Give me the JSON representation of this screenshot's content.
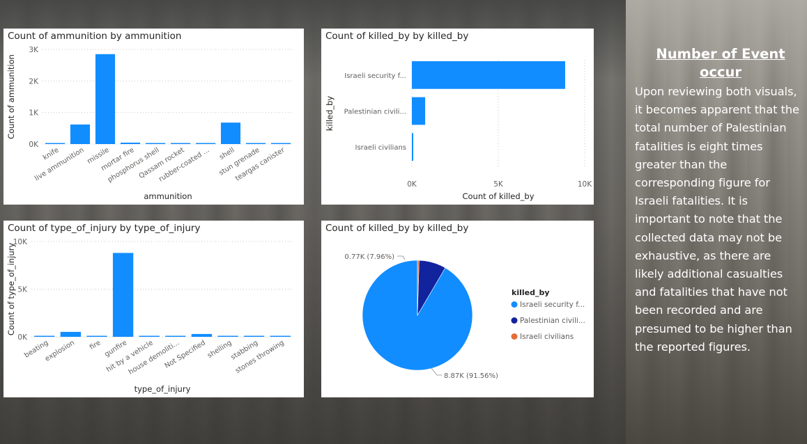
{
  "story": {
    "title": "Number of Event occur ",
    "body": "Upon reviewing both visuals, it becomes apparent that the total number of Palestinian fatalities is eight times greater than the corresponding figure for Israeli fatalities. It is important to note that the collected data may not be exhaustive, as there are likely additional casualties and fatalities that have not been recorded and are presumed to be higher than the reported figures."
  },
  "colors": {
    "bar": "#118DFF",
    "pie_israeli_security": "#118DFF",
    "pie_palestinian_civilians": "#12239E",
    "pie_israeli_civilians": "#E66C37"
  },
  "chart_data": [
    {
      "type": "bar",
      "title": "Count of ammunition by ammunition",
      "xlabel": "ammunition",
      "ylabel": "Count of ammunition",
      "yticks": [
        "0K",
        "1K",
        "2K",
        "3K"
      ],
      "ylim": [
        0,
        3000
      ],
      "categories": [
        "knife",
        "live ammunition",
        "missile",
        "mortar fire",
        "phosphorus shell",
        "Qassam rocket",
        "rubber-coated ...",
        "shell",
        "stun grenade",
        "teargas canister"
      ],
      "values": [
        25,
        620,
        2850,
        45,
        10,
        8,
        15,
        680,
        12,
        14
      ]
    },
    {
      "type": "bar",
      "orientation": "horizontal",
      "title": "Count of killed_by by killed_by",
      "xlabel": "Count of killed_by",
      "ylabel": "killed_by",
      "xticks": [
        "0K",
        "5K",
        "10K"
      ],
      "xlim": [
        0,
        10000
      ],
      "categories": [
        "Israeli security f...",
        "Palestinian civili...",
        "Israeli civilians"
      ],
      "values": [
        8870,
        770,
        50
      ]
    },
    {
      "type": "bar",
      "title": "Count of type_of_injury by type_of_injury",
      "xlabel": "type_of_injury",
      "ylabel": "Count of type_of_injury",
      "yticks": [
        "0K",
        "5K",
        "10K"
      ],
      "ylim": [
        0,
        10000
      ],
      "categories": [
        "beating",
        "explosion",
        "fire",
        "gunfire",
        "hit by a vehicle",
        "house demoliti...",
        "Not Specified",
        "shelling",
        "stabbing",
        "stones throwing"
      ],
      "values": [
        40,
        520,
        60,
        8800,
        45,
        40,
        300,
        45,
        30,
        35
      ]
    },
    {
      "type": "pie",
      "title": "Count of killed_by by killed_by",
      "legend_title": "killed_by",
      "legend_position": "right",
      "slices": [
        {
          "label": "Israeli security f...",
          "value": 8870,
          "data_label": "8.87K (91.56%)"
        },
        {
          "label": "Palestinian civili...",
          "value": 771,
          "data_label": "0.77K (7.96%)"
        },
        {
          "label": "Israeli civilians",
          "value": 46,
          "data_label": ""
        }
      ]
    }
  ]
}
